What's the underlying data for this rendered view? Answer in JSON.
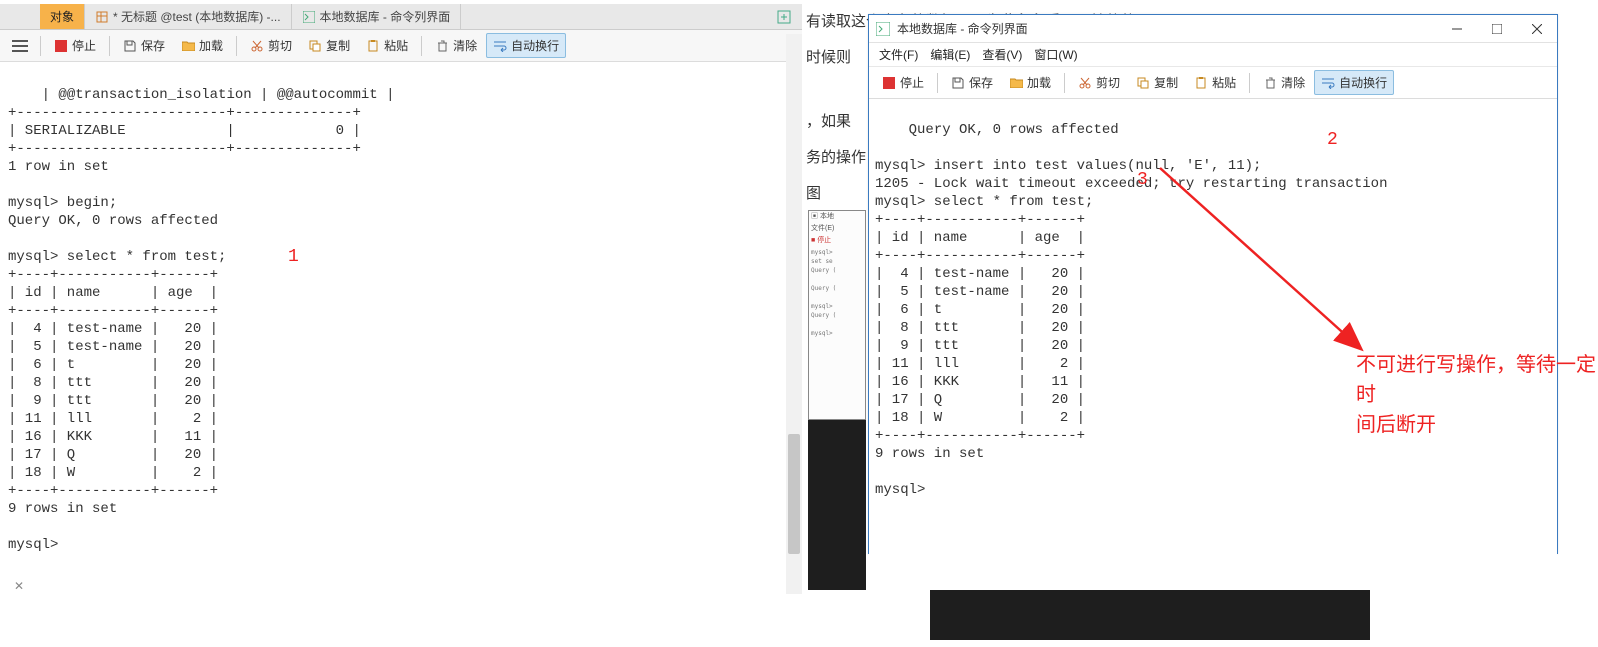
{
  "left": {
    "tabs": {
      "object": "对象",
      "untitled": "* 无标题 @test (本地数据库) -...",
      "cli": "本地数据库 - 命令列界面"
    },
    "toolbar": {
      "stop": "停止",
      "save": "保存",
      "load": "加载",
      "cut": "剪切",
      "copy": "复制",
      "paste": "粘贴",
      "clear": "清除",
      "wrap": "自动换行"
    },
    "annot1": "1",
    "console_text": "| @@transaction_isolation | @@autocommit |\n+-------------------------+--------------+\n| SERIALIZABLE            |            0 |\n+-------------------------+--------------+\n1 row in set\n\nmysql> begin;\nQuery OK, 0 rows affected\n\nmysql> select * from test;\n+----+-----------+------+\n| id | name      | age  |\n+----+-----------+------+\n|  4 | test-name |   20 |\n|  5 | test-name |   20 |\n|  6 | t         |   20 |\n|  8 | ttt       |   20 |\n|  9 | ttt       |   20 |\n| 11 | lll       |    2 |\n| 16 | KKK       |   11 |\n| 17 | Q         |   20 |\n| 18 | W         |    2 |\n+----+-----------+------+\n9 rows in set\n\nmysql> "
  },
  "bg": {
    "l1": "有读取这个事务的数据，因为此段段重要开始的的",
    "l2": "时候则",
    "l3": "，如果",
    "l4": "务的操作",
    "l5": "图"
  },
  "right": {
    "title": "本地数据库 - 命令列界面",
    "menu": {
      "file": "文件(F)",
      "edit": "编辑(E)",
      "view": "查看(V)",
      "window": "窗口(W)"
    },
    "toolbar": {
      "stop": "停止",
      "save": "保存",
      "load": "加载",
      "cut": "剪切",
      "copy": "复制",
      "paste": "粘贴",
      "clear": "清除",
      "wrap": "自动换行"
    },
    "annot2": "2",
    "annot3": "3",
    "console_text": "Query OK, 0 rows affected\n\nmysql> insert into test values(null, 'E', 11);\n1205 - Lock wait timeout exceeded; try restarting transaction\nmysql> select * from test;\n+----+-----------+------+\n| id | name      | age  |\n+----+-----------+------+\n|  4 | test-name |   20 |\n|  5 | test-name |   20 |\n|  6 | t         |   20 |\n|  8 | ttt       |   20 |\n|  9 | ttt       |   20 |\n| 11 | lll       |    2 |\n| 16 | KKK       |   11 |\n| 17 | Q         |   20 |\n| 18 | W         |    2 |\n+----+-----------+------+\n9 rows in set\n\nmysql> "
  },
  "mini": {
    "title": "本地",
    "file": "文件(E)",
    "stop": "停止",
    "l1": "mysql>",
    "l2": "set se",
    "l3": "Query (",
    "l4": "Query (",
    "l5": "mysql>",
    "l6": "Query (",
    "l7": "mysql>"
  },
  "annotation": {
    "l1": "不可进行写操作，等待一定时",
    "l2": "间后断开"
  },
  "chart_data": {
    "type": "table",
    "title": "select * from test",
    "columns": [
      "id",
      "name",
      "age"
    ],
    "rows": [
      [
        4,
        "test-name",
        20
      ],
      [
        5,
        "test-name",
        20
      ],
      [
        6,
        "t",
        20
      ],
      [
        8,
        "ttt",
        20
      ],
      [
        9,
        "ttt",
        20
      ],
      [
        11,
        "lll",
        2
      ],
      [
        16,
        "KKK",
        11
      ],
      [
        17,
        "Q",
        20
      ],
      [
        18,
        "W",
        2
      ]
    ],
    "row_count": 9
  }
}
